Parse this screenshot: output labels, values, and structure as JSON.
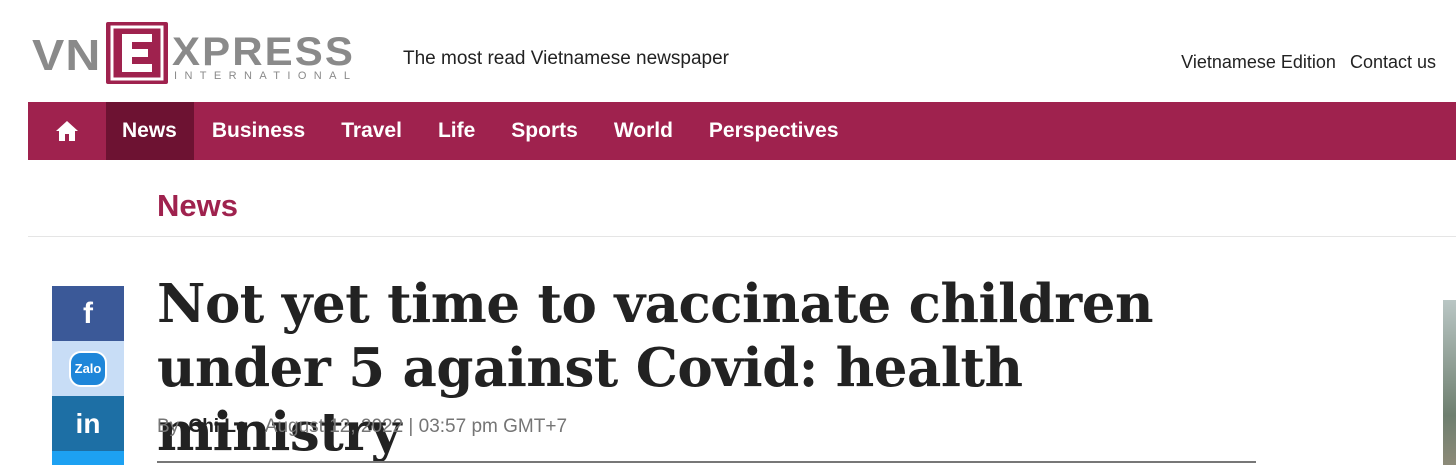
{
  "header": {
    "logo": {
      "vn": "VN",
      "e": "E",
      "xpress": "XPRESS",
      "international": "INTERNATIONAL"
    },
    "tagline": "The most read Vietnamese newspaper",
    "links": [
      "Vietnamese Edition",
      "Contact us"
    ]
  },
  "nav": {
    "home_icon": "home-icon",
    "items": [
      "News",
      "Business",
      "Travel",
      "Life",
      "Sports",
      "World",
      "Perspectives"
    ],
    "active": "News"
  },
  "section": {
    "label": "News"
  },
  "share": {
    "facebook": "f",
    "zalo": "Zalo",
    "linkedin": "in"
  },
  "article": {
    "headline": "Not yet time to vaccinate children under 5 against Covid: health ministry",
    "by": "By",
    "author": "Chi Le",
    "date": "August 12, 2022 | 03:57 pm GMT+7"
  },
  "colors": {
    "brand": "#9f224e",
    "active_nav": "#6d1232"
  }
}
